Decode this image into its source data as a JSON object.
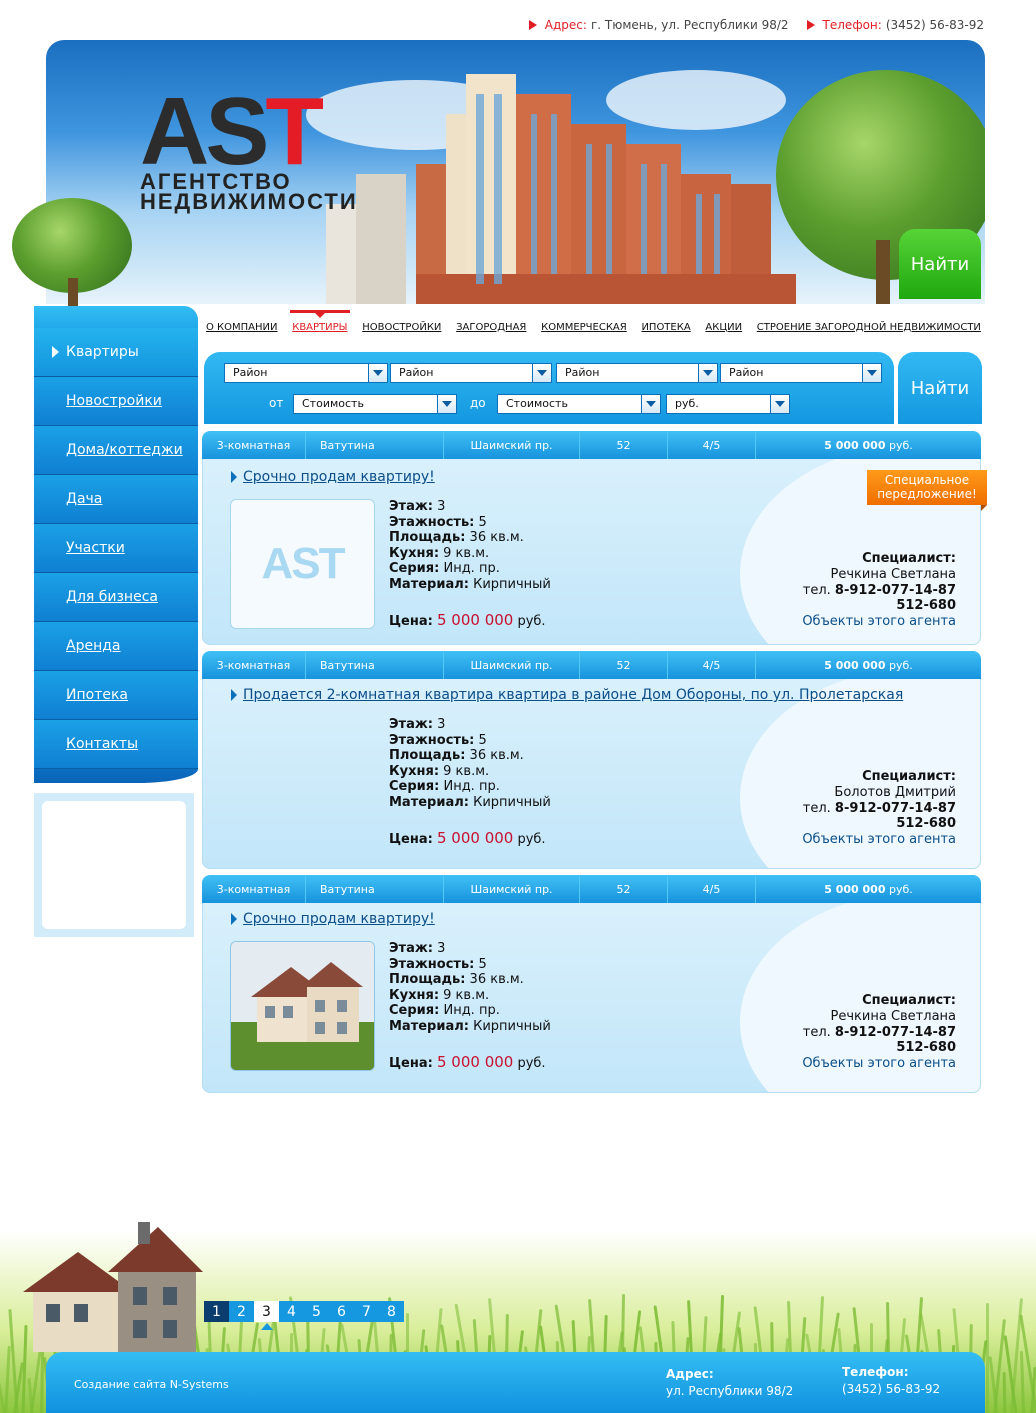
{
  "topbar": {
    "address_label": "Адрес:",
    "address": "г. Тюмень, ул. Республики 98/2",
    "phone_label": "Телефон:",
    "phone": "(3452) 56-83-92"
  },
  "logo": {
    "brand": "AST",
    "line1": "АГЕНТСТВО",
    "line2": "НЕДВИЖИМОСТИ"
  },
  "header": {
    "find_label": "Найти"
  },
  "sidebar": {
    "items": [
      {
        "label": "Квартиры"
      },
      {
        "label": "Новостройки"
      },
      {
        "label": "Дома/коттеджи"
      },
      {
        "label": "Дача"
      },
      {
        "label": "Участки"
      },
      {
        "label": "Для бизнеса"
      },
      {
        "label": "Аренда"
      },
      {
        "label": "Ипотека"
      },
      {
        "label": "Контакты"
      }
    ]
  },
  "nav": {
    "items": [
      {
        "label": "О КОМПАНИИ"
      },
      {
        "label": "КВАРТИРЫ"
      },
      {
        "label": "НОВОСТРОЙКИ"
      },
      {
        "label": "ЗАГОРОДНАЯ"
      },
      {
        "label": "КОММЕРЧЕСКАЯ"
      },
      {
        "label": "ИПОТЕКА"
      },
      {
        "label": "АКЦИИ"
      },
      {
        "label": "СТРОЕНИЕ ЗАГОРОДНОЙ НЕДВИЖИМОСТИ"
      }
    ]
  },
  "search": {
    "district_1": "Район",
    "district_2": "Район",
    "district_3": "Район",
    "district_4": "Район",
    "from_label": "от",
    "to_label": "до",
    "price_from": "Стоимость",
    "price_to": "Стоимость",
    "currency": "руб.",
    "find_label": "Найти"
  },
  "special_offer": "Специальное передложение!",
  "listings": [
    {
      "bar": {
        "rooms": "3-комнатная",
        "district": "Ватутина",
        "street": "Шаимский пр.",
        "house": "52",
        "floor": "4/5",
        "price": "5 000 000",
        "currency": "руб."
      },
      "title": "Срочно продам квартиру!",
      "photo": "logo",
      "specs": {
        "floor_label": "Этаж:",
        "floor": "3",
        "floors_label": "Этажность:",
        "floors": "5",
        "area_label": "Площадь:",
        "area": "36 кв.м.",
        "kitchen_label": "Кухня:",
        "kitchen": "9 кв.м.",
        "series_label": "Серия:",
        "series": "Инд. пр.",
        "material_label": "Материал:",
        "material": "Кирпичный"
      },
      "price_label": "Цена:",
      "price": "5 000 000",
      "currency": "руб.",
      "agent": {
        "label": "Специалист:",
        "name": "Речкина Светлана",
        "tel_label": "тел.",
        "tel": "8-912-077-14-87",
        "tel2": "512-680",
        "link": "Объекты этого агента"
      }
    },
    {
      "bar": {
        "rooms": "3-комнатная",
        "district": "Ватутина",
        "street": "Шаимский пр.",
        "house": "52",
        "floor": "4/5",
        "price": "5 000 000",
        "currency": "руб."
      },
      "title": "Продается 2-комнатная квартира квартира в районе Дом Обороны, по ул. Пролетарская",
      "photo": "none",
      "specs": {
        "floor_label": "Этаж:",
        "floor": "3",
        "floors_label": "Этажность:",
        "floors": "5",
        "area_label": "Площадь:",
        "area": "36 кв.м.",
        "kitchen_label": "Кухня:",
        "kitchen": "9 кв.м.",
        "series_label": "Серия:",
        "series": "Инд. пр.",
        "material_label": "Материал:",
        "material": "Кирпичный"
      },
      "price_label": "Цена:",
      "price": "5 000 000",
      "currency": "руб.",
      "agent": {
        "label": "Специалист:",
        "name": "Болотов Дмитрий",
        "tel_label": "тел.",
        "tel": "8-912-077-14-87",
        "tel2": "512-680",
        "link": "Объекты этого агента"
      }
    },
    {
      "bar": {
        "rooms": "3-комнатная",
        "district": "Ватутина",
        "street": "Шаимский пр.",
        "house": "52",
        "floor": "4/5",
        "price": "5 000 000",
        "currency": "руб."
      },
      "title": "Срочно продам квартиру!",
      "photo": "house",
      "specs": {
        "floor_label": "Этаж:",
        "floor": "3",
        "floors_label": "Этажность:",
        "floors": "5",
        "area_label": "Площадь:",
        "area": "36 кв.м.",
        "kitchen_label": "Кухня:",
        "kitchen": "9 кв.м.",
        "series_label": "Серия:",
        "series": "Инд. пр.",
        "material_label": "Материал:",
        "material": "Кирпичный"
      },
      "price_label": "Цена:",
      "price": "5 000 000",
      "currency": "руб.",
      "agent": {
        "label": "Специалист:",
        "name": "Речкина Светлана",
        "tel_label": "тел.",
        "tel": "8-912-077-14-87",
        "tel2": "512-680",
        "link": "Объекты этого агента"
      }
    }
  ],
  "pagination": {
    "pages": [
      "1",
      "2",
      "3",
      "4",
      "5",
      "6",
      "7",
      "8"
    ],
    "current": "3"
  },
  "footer": {
    "credit_text": "Создание сайта",
    "credit_link": "N-Systems",
    "address_label": "Адрес:",
    "address": "ул. Республики 98/2",
    "phone_label": "Телефон:",
    "phone": "(3452) 56-83-92"
  },
  "colors": {
    "accent_blue": "#1693dd",
    "accent_red": "#e01e24",
    "find_green": "#1fa80f",
    "special_orange": "#f06e00"
  }
}
